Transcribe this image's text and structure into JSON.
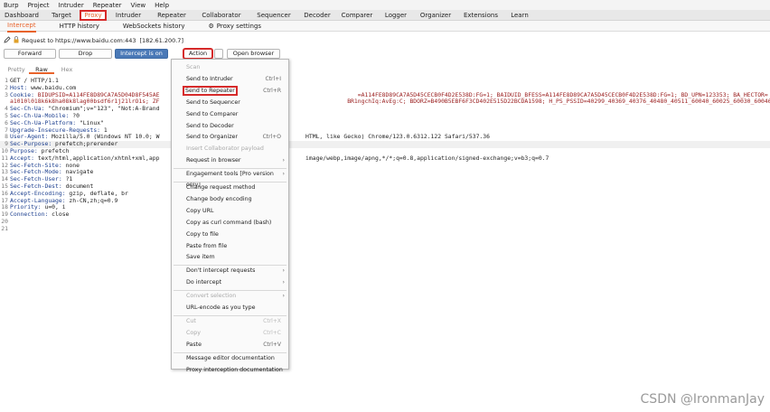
{
  "menubar": [
    "Burp",
    "Project",
    "Intruder",
    "Repeater",
    "View",
    "Help"
  ],
  "main_tabs": [
    "Dashboard",
    "Target",
    "Proxy",
    "Intruder",
    "Repeater",
    "Collaborator",
    "Sequencer",
    "Decoder",
    "Comparer",
    "Logger",
    "Organizer",
    "Extensions",
    "Learn"
  ],
  "sub_tabs": [
    "Intercept",
    "HTTP history",
    "WebSockets history"
  ],
  "proxy_settings": "Proxy settings",
  "request_info": {
    "label": "Request to https://www.baidu.com:443",
    "ip": "[182.61.200.7]"
  },
  "buttons": {
    "forward": "Forward",
    "drop": "Drop",
    "intercept": "Intercept is on",
    "action": "Action",
    "open_browser": "Open browser"
  },
  "view_tabs": [
    "Pretty",
    "Raw",
    "Hex"
  ],
  "request_lines": [
    {
      "n": "1",
      "k": "",
      "v": "GET / HTTP/1.1"
    },
    {
      "n": "2",
      "k": "Host: ",
      "v": "www.baidu.com"
    },
    {
      "n": "3",
      "k": "Cookie: ",
      "v": "BIDUPSID=A114FE8D89CA7A5D04D8F545AE                                                         =A114FE8D89CA7A5D45CECB0F4D2E538D:FG=1; BAIDUID_BFESS=A114FE8D89CA7A5D45CECB0F4D2E538D:FG=1; BD_UPN=123353; BA_HECTOR="
    },
    {
      "n": "",
      "k": "",
      "v": "a1010l018k6k8ha08k8lag00bsdf6r1j21lrO1s; ZF                                                      BR1ngchIq:AvEg:C; BDORZ=B490B5EBF6F3CD402E515D22BCDA1598; H_PS_PSSID=40299_40369_40376_40480_40511_60040_60025_60030_60046_40080"
    },
    {
      "n": "4",
      "k": "Sec-Ch-Ua: ",
      "v": "\"Chromium\";v=\"123\", \"Not:A-Brand"
    },
    {
      "n": "5",
      "k": "Sec-Ch-Ua-Mobile: ",
      "v": "?0"
    },
    {
      "n": "6",
      "k": "Sec-Ch-Ua-Platform: ",
      "v": "\"Linux\""
    },
    {
      "n": "7",
      "k": "Upgrade-Insecure-Requests: ",
      "v": "1"
    },
    {
      "n": "8",
      "k": "User-Agent: ",
      "v": "Mozilla/5.0 (Windows NT 10.0; W                                          HTML, like Gecko) Chrome/123.0.6312.122 Safari/537.36"
    },
    {
      "n": "9",
      "k": "Sec-Purpose: ",
      "v": "prefetch;prerender"
    },
    {
      "n": "10",
      "k": "Purpose: ",
      "v": "prefetch"
    },
    {
      "n": "11",
      "k": "Accept: ",
      "v": "text/html,application/xhtml+xml,app                                          image/webp,image/apng,*/*;q=0.8,application/signed-exchange;v=b3;q=0.7"
    },
    {
      "n": "12",
      "k": "Sec-Fetch-Site: ",
      "v": "none"
    },
    {
      "n": "13",
      "k": "Sec-Fetch-Mode: ",
      "v": "navigate"
    },
    {
      "n": "14",
      "k": "Sec-Fetch-User: ",
      "v": "?1"
    },
    {
      "n": "15",
      "k": "Sec-Fetch-Dest: ",
      "v": "document"
    },
    {
      "n": "16",
      "k": "Accept-Encoding: ",
      "v": "gzip, deflate, br"
    },
    {
      "n": "17",
      "k": "Accept-Language: ",
      "v": "zh-CN,zh;q=0.9"
    },
    {
      "n": "18",
      "k": "Priority: ",
      "v": "u=0, i"
    },
    {
      "n": "19",
      "k": "Connection: ",
      "v": "close"
    },
    {
      "n": "20",
      "k": "",
      "v": ""
    },
    {
      "n": "21",
      "k": "",
      "v": ""
    }
  ],
  "context_menu": [
    {
      "label": "Scan",
      "shortcut": "",
      "disabled": true
    },
    {
      "label": "Send to Intruder",
      "shortcut": "Ctrl+I"
    },
    {
      "label": "Send to Repeater",
      "shortcut": "Ctrl+R",
      "boxed": true
    },
    {
      "label": "Send to Sequencer",
      "shortcut": ""
    },
    {
      "label": "Send to Comparer",
      "shortcut": ""
    },
    {
      "label": "Send to Decoder",
      "shortcut": ""
    },
    {
      "label": "Send to Organizer",
      "shortcut": "Ctrl+O"
    },
    {
      "label": "Insert Collaborator payload",
      "shortcut": "",
      "disabled": true
    },
    {
      "label": "Request in browser",
      "shortcut": "",
      "submenu": true
    },
    {
      "sep": true
    },
    {
      "label": "Engagement tools [Pro version only]",
      "shortcut": "",
      "submenu": true
    },
    {
      "sep": true
    },
    {
      "label": "Change request method",
      "shortcut": ""
    },
    {
      "label": "Change body encoding",
      "shortcut": ""
    },
    {
      "label": "Copy URL",
      "shortcut": ""
    },
    {
      "label": "Copy as curl command (bash)",
      "shortcut": ""
    },
    {
      "label": "Copy to file",
      "shortcut": ""
    },
    {
      "label": "Paste from file",
      "shortcut": ""
    },
    {
      "label": "Save item",
      "shortcut": ""
    },
    {
      "sep": true
    },
    {
      "label": "Don't intercept requests",
      "shortcut": "",
      "submenu": true
    },
    {
      "label": "Do intercept",
      "shortcut": "",
      "submenu": true
    },
    {
      "sep": true
    },
    {
      "label": "Convert selection",
      "shortcut": "",
      "submenu": true,
      "disabled": true
    },
    {
      "label": "URL-encode as you type",
      "shortcut": ""
    },
    {
      "sep": true
    },
    {
      "label": "Cut",
      "shortcut": "Ctrl+X",
      "disabled": true
    },
    {
      "label": "Copy",
      "shortcut": "Ctrl+C",
      "disabled": true
    },
    {
      "label": "Paste",
      "shortcut": "Ctrl+V"
    },
    {
      "sep": true
    },
    {
      "label": "Message editor documentation",
      "shortcut": ""
    },
    {
      "label": "Proxy interception documentation",
      "shortcut": ""
    }
  ],
  "watermark": "CSDN @IronmanJay"
}
